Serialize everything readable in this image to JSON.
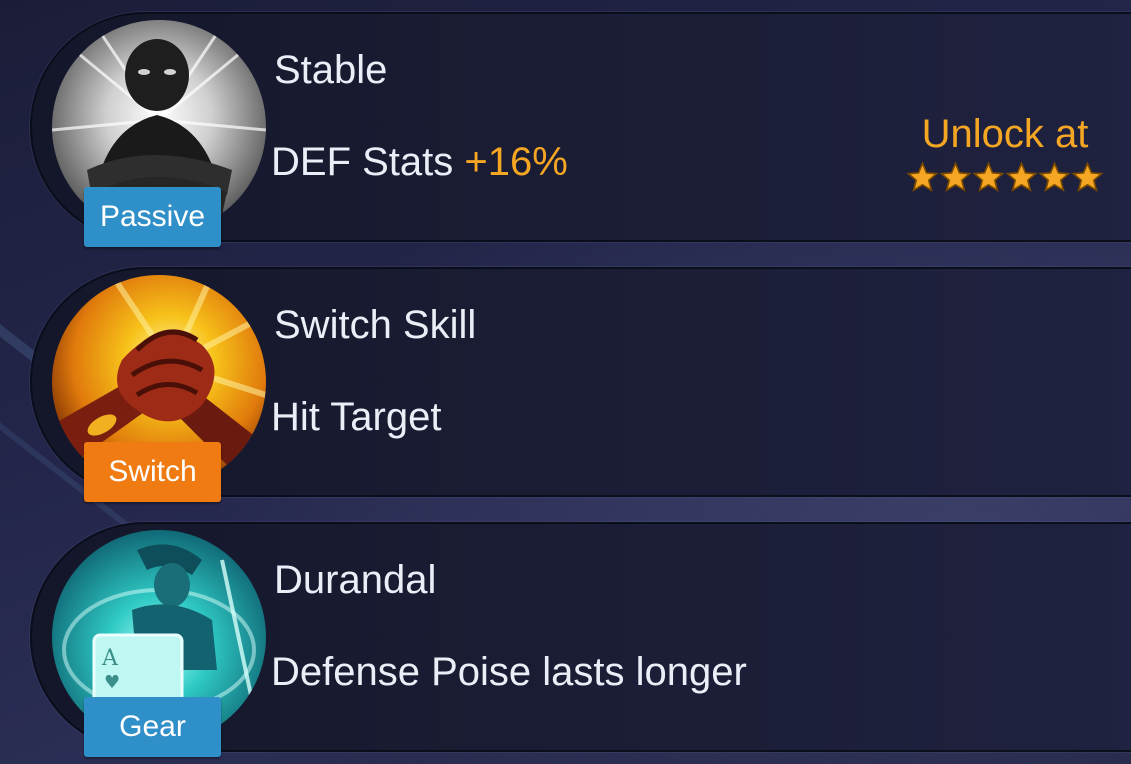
{
  "skills": [
    {
      "title": "Stable",
      "desc_main": "DEF Stats",
      "desc_bonus": "+16%",
      "tag": "Passive",
      "icon": "arms-crossed-figure-icon",
      "unlock": {
        "label": "Unlock at",
        "stars": 6
      }
    },
    {
      "title": "Switch Skill",
      "desc_main": "Hit Target",
      "tag": "Switch",
      "icon": "clasped-hands-icon"
    },
    {
      "title": "Durandal",
      "desc_main": "Defense Poise lasts longer",
      "tag": "Gear",
      "icon": "durandal-card-icon"
    }
  ],
  "colors": {
    "accent_orange": "#f5a623",
    "tag_blue": "#2f8fc8",
    "tag_orange": "#ef7b12",
    "text": "#e9eef7"
  }
}
